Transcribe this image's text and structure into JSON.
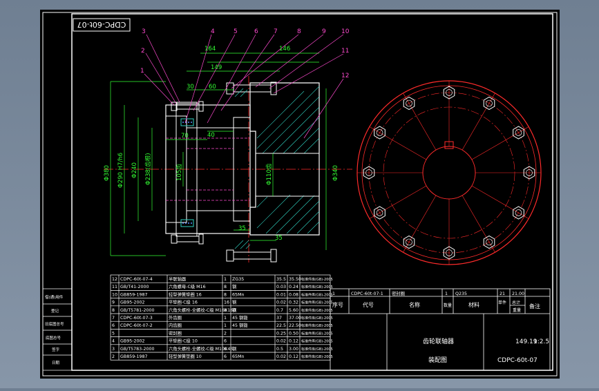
{
  "title_tag": "CDPC-60t-07",
  "balloons": [
    "1",
    "2",
    "3",
    "4",
    "5",
    "6",
    "7",
    "8",
    "9",
    "10",
    "11",
    "12"
  ],
  "dims": {
    "d164": "164",
    "d146": "146",
    "d149": "149",
    "d30": "30",
    "d60": "60",
    "d40": "40",
    "d70": "70",
    "d35a": "35",
    "d35b": "35",
    "dia380": "Φ380",
    "dia290": "Φ290 H7/h6",
    "dia240": "Φ240",
    "dia238": "Φ238(齿根)",
    "dia105": "105齿",
    "dia110": "Φ110齿",
    "dia340": "Φ340"
  },
  "bom": {
    "rows": [
      [
        "12",
        "CDPC-60t-07-4",
        "半联轴器",
        "1",
        "ZG35",
        "35.5",
        "35.50"
      ],
      [
        "11",
        "GB/T41-2000",
        "六角螺母-C级 M16",
        "8",
        "钢",
        "0.03",
        "0.24"
      ],
      [
        "10",
        "GB859-1987",
        "轻型弹簧垫圈 16",
        "8",
        "65Mn",
        "0.01",
        "0.08"
      ],
      [
        "9",
        "GB95-2002",
        "平垫圈-C级 16",
        "16",
        "钢",
        "0.02",
        "0.32"
      ],
      [
        "8",
        "GB/T5781-2000",
        "六角头螺栓-全螺纹-C级 M16X160",
        "8",
        "钢",
        "0.7",
        "5.60"
      ],
      [
        "7",
        "CDPC-60t-07-3",
        "外齿圈",
        "1",
        "45 钢锻",
        "37",
        "37.00"
      ],
      [
        "6",
        "CDPC-60t-07-2",
        "内齿圈",
        "1",
        "45 钢锻",
        "22.5",
        "22.50"
      ],
      [
        "5",
        "",
        "密封圈",
        "2",
        "",
        "0.25",
        "0.50"
      ],
      [
        "4",
        "GB95-2002",
        "平垫圈-C级 10",
        "6",
        "",
        "0.02",
        "0.12"
      ],
      [
        "3",
        "GB/T5783-2000",
        "六角头螺栓-全螺纹-C级 M10X45",
        "6",
        "钢",
        "0.5",
        "3.00"
      ],
      [
        "2",
        "GB859-1987",
        "轻型弹簧垫圈 10",
        "6",
        "65Mn",
        "0.02",
        "0.12"
      ]
    ],
    "row1": [
      "1",
      "CDPC-60t-07-1",
      "密封圈",
      "1",
      "Q235",
      "21",
      "21.00"
    ],
    "header": {
      "seq": "序号",
      "code": "代号",
      "name": "名称",
      "qty": "数量",
      "material": "材料",
      "unit_w": "单件",
      "total_w": "总计",
      "weight": "重量",
      "remark": "备注"
    },
    "note_short": "标准件库(GB)-2005"
  },
  "title_block": {
    "name": "齿轮联轴器",
    "drawing": "装配图",
    "mass": "149.19",
    "scale": "1:2.5",
    "code": "CDPC-60t-07"
  },
  "side_labels": [
    "借(通)用件",
    "登记",
    "旧底图总号",
    "底图总号",
    "签字",
    "日期"
  ]
}
